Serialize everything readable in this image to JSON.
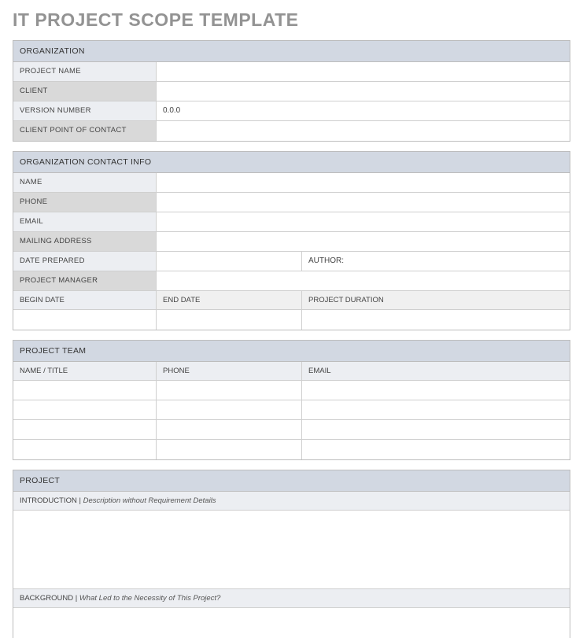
{
  "page_title": "IT PROJECT SCOPE TEMPLATE",
  "organization": {
    "header": "ORGANIZATION",
    "project_name_label": "PROJECT NAME",
    "project_name_value": "",
    "client_label": "CLIENT",
    "client_value": "",
    "version_number_label": "VERSION NUMBER",
    "version_number_value": " 0.0.0",
    "cpoc_label": "CLIENT POINT OF CONTACT",
    "cpoc_value": ""
  },
  "org_contact": {
    "header": "ORGANIZATION CONTACT INFO",
    "name_label": "NAME",
    "name_value": "",
    "phone_label": "PHONE",
    "phone_value": "",
    "email_label": "EMAIL",
    "email_value": "",
    "mailing_label": "MAILING ADDRESS",
    "mailing_value": "",
    "date_prepared_label": "DATE PREPARED",
    "date_prepared_value": "",
    "author_label": "AUTHOR:",
    "author_value": "",
    "project_manager_label": "PROJECT MANAGER",
    "project_manager_value": "",
    "begin_date_label": "BEGIN DATE",
    "end_date_label": "END DATE",
    "project_duration_label": "PROJECT DURATION",
    "begin_date_value": "",
    "end_date_value": "",
    "project_duration_value": ""
  },
  "project_team": {
    "header": "PROJECT TEAM",
    "col_name": "NAME / TITLE",
    "col_phone": "PHONE",
    "col_email": "EMAIL",
    "rows": [
      {
        "name": "",
        "phone": "",
        "email": ""
      },
      {
        "name": "",
        "phone": "",
        "email": ""
      },
      {
        "name": "",
        "phone": "",
        "email": ""
      },
      {
        "name": "",
        "phone": "",
        "email": ""
      }
    ]
  },
  "project": {
    "header": "PROJECT",
    "intro_label": "INTRODUCTION | ",
    "intro_desc": "Description without Requirement Details",
    "intro_value": "",
    "background_label": "BACKGROUND | ",
    "background_desc": "What Led to the Necessity of This Project?",
    "background_value": ""
  }
}
